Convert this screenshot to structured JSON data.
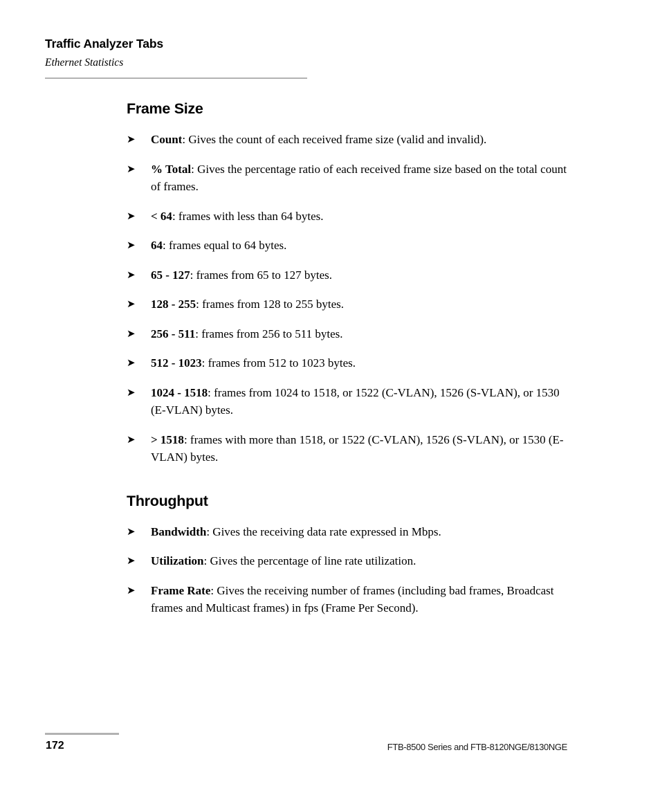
{
  "page": {
    "running_header": {
      "title": "Traffic Analyzer Tabs",
      "subtitle": "Ethernet Statistics"
    },
    "footer": {
      "page_number": "172",
      "product_line": "FTB-8500 Series and FTB-8120NGE/8130NGE"
    },
    "bullet_glyph": "➤",
    "rule_color": "#b2b2b2"
  },
  "sections": [
    {
      "heading": "Frame Size",
      "items": [
        {
          "term": "Count",
          "description": ": Gives the count of each received frame size (valid and invalid)."
        },
        {
          "term": "% Total",
          "description": ": Gives the percentage ratio of each received frame size based on the total count of frames."
        },
        {
          "term": "< 64",
          "description": ": frames with less than 64 bytes."
        },
        {
          "term": "64",
          "description": ": frames equal to 64 bytes."
        },
        {
          "term": "65 - 127",
          "description": ": frames from 65 to 127 bytes."
        },
        {
          "term": "128 - 255",
          "description": ": frames from 128 to 255 bytes."
        },
        {
          "term": "256 - 511",
          "description": ": frames from 256 to 511 bytes."
        },
        {
          "term": "512 - 1023",
          "description": ": frames from 512 to 1023 bytes."
        },
        {
          "term": "1024 - 1518",
          "description": ": frames from 1024 to 1518, or 1522 (C-VLAN), 1526 (S-VLAN), or 1530 (E-VLAN) bytes."
        },
        {
          "term": "> 1518",
          "description": ": frames with more than 1518, or 1522 (C-VLAN), 1526 (S-VLAN), or 1530 (E-VLAN) bytes."
        }
      ]
    },
    {
      "heading": "Throughput",
      "items": [
        {
          "term": "Bandwidth",
          "description": ": Gives the receiving data rate expressed in Mbps."
        },
        {
          "term": "Utilization",
          "description": ": Gives the percentage of line rate utilization."
        },
        {
          "term": "Frame Rate",
          "description": ": Gives the receiving number of frames (including bad frames, Broadcast frames and Multicast frames) in fps (Frame Per Second)."
        }
      ]
    }
  ]
}
